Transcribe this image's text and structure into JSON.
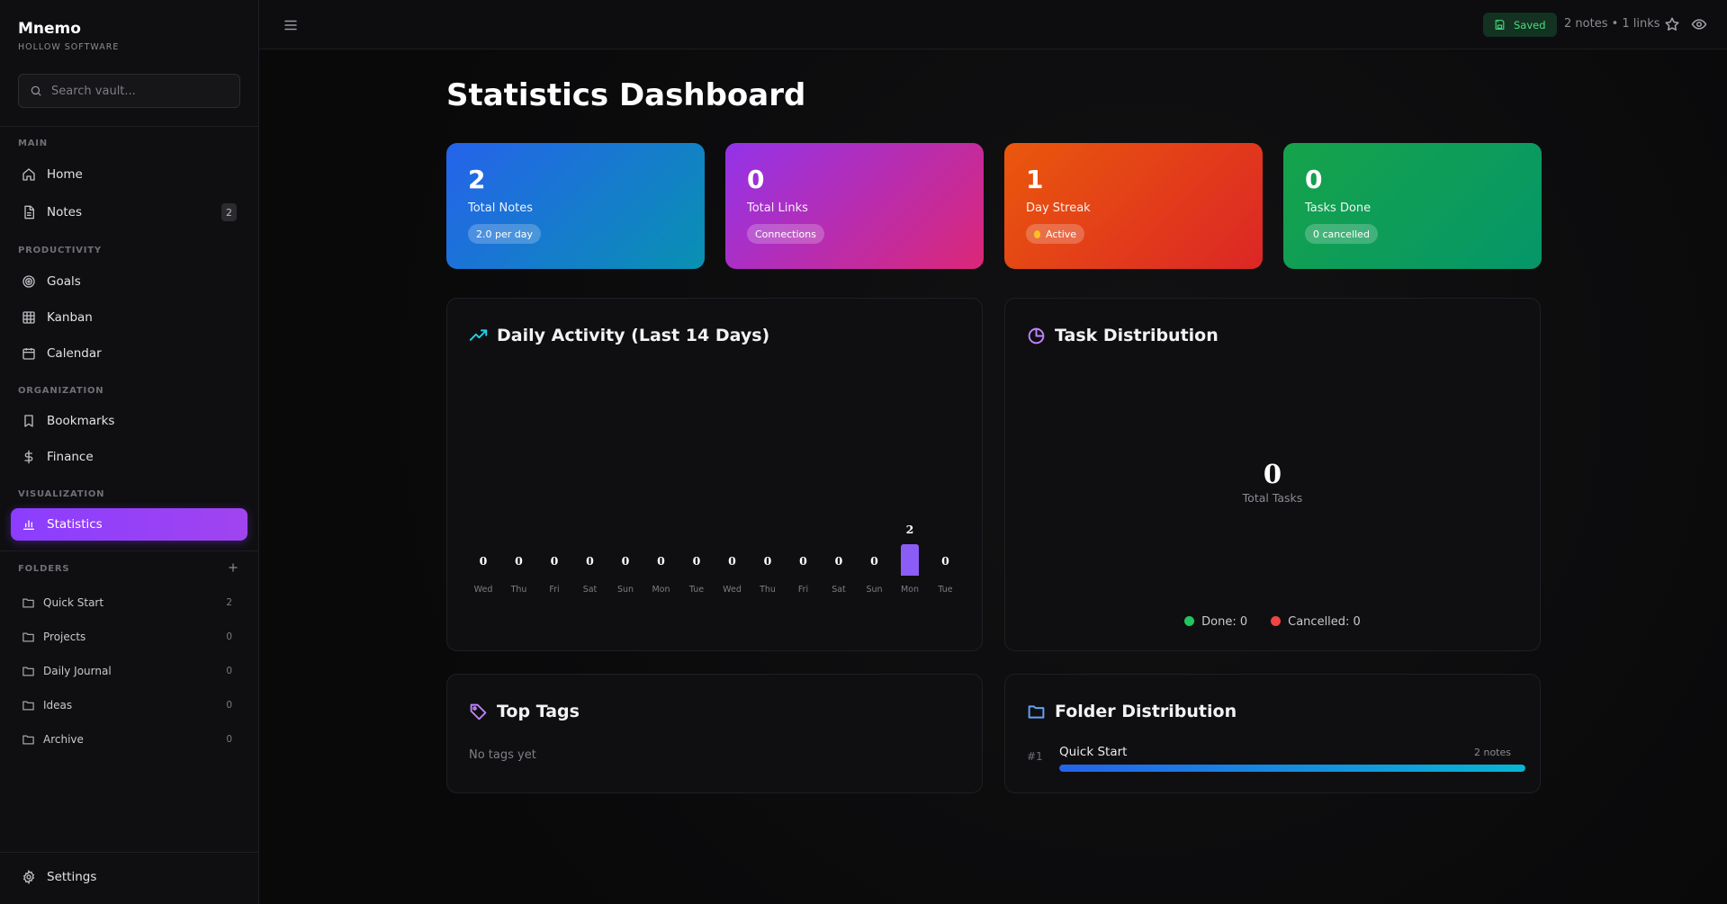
{
  "app": {
    "name": "Mnemo",
    "subtitle": "HOLLOW SOFTWARE"
  },
  "search": {
    "placeholder": "Search vault..."
  },
  "sidebar": {
    "sections": {
      "main": "MAIN",
      "productivity": "PRODUCTIVITY",
      "organization": "ORGANIZATION",
      "visualization": "VISUALIZATION",
      "folders": "FOLDERS"
    },
    "items": {
      "home": "Home",
      "notes": "Notes",
      "notes_count": "2",
      "goals": "Goals",
      "kanban": "Kanban",
      "calendar": "Calendar",
      "bookmarks": "Bookmarks",
      "finance": "Finance",
      "statistics": "Statistics"
    },
    "folders": [
      {
        "name": "Quick Start",
        "count": "2"
      },
      {
        "name": "Projects",
        "count": "0"
      },
      {
        "name": "Daily Journal",
        "count": "0"
      },
      {
        "name": "Ideas",
        "count": "0"
      },
      {
        "name": "Archive",
        "count": "0"
      }
    ],
    "settings": "Settings",
    "active": "statistics"
  },
  "topbar": {
    "saved": "Saved",
    "stats": "2 notes • 1 links"
  },
  "page": {
    "title": "Statistics Dashboard"
  },
  "cards": [
    {
      "value": "2",
      "label": "Total Notes",
      "pill": "2.0 per day",
      "from": "#2563eb",
      "to": "#0891b2"
    },
    {
      "value": "0",
      "label": "Total Links",
      "pill": "Connections",
      "from": "#9333ea",
      "to": "#db2777"
    },
    {
      "value": "1",
      "label": "Day Streak",
      "pill": "Active",
      "from": "#ea580c",
      "to": "#dc2626"
    },
    {
      "value": "0",
      "label": "Tasks Done",
      "pill": "0 cancelled",
      "from": "#16a34a",
      "to": "#059669"
    }
  ],
  "daily_activity": {
    "title": "Daily Activity (Last 14 Days)",
    "icon": "trending-up-icon",
    "accent": "#22d3ee"
  },
  "task_distribution": {
    "title": "Task Distribution",
    "icon": "pie-chart-icon",
    "accent": "#c084fc",
    "total": "0",
    "total_label": "Total Tasks",
    "legend": [
      {
        "label": "Done: 0",
        "color": "#22c55e"
      },
      {
        "label": "Cancelled: 0",
        "color": "#ef4444"
      }
    ]
  },
  "top_tags": {
    "title": "Top Tags",
    "icon": "tag-icon",
    "empty": "No tags yet",
    "accent": "#c084fc"
  },
  "folder_distribution": {
    "title": "Folder Distribution",
    "icon": "folder-icon",
    "accent": "#60a5fa",
    "items": [
      {
        "rank": "#1",
        "name": "Quick Start",
        "notes": "2 notes",
        "share": 1.0
      }
    ]
  },
  "chart_data": {
    "type": "bar",
    "title": "Daily Activity (Last 14 Days)",
    "categories": [
      "Wed",
      "Thu",
      "Fri",
      "Sat",
      "Sun",
      "Mon",
      "Tue",
      "Wed",
      "Thu",
      "Fri",
      "Sat",
      "Sun",
      "Mon",
      "Tue"
    ],
    "values": [
      0,
      0,
      0,
      0,
      0,
      0,
      0,
      0,
      0,
      0,
      0,
      0,
      2,
      0
    ],
    "grid": false
  }
}
